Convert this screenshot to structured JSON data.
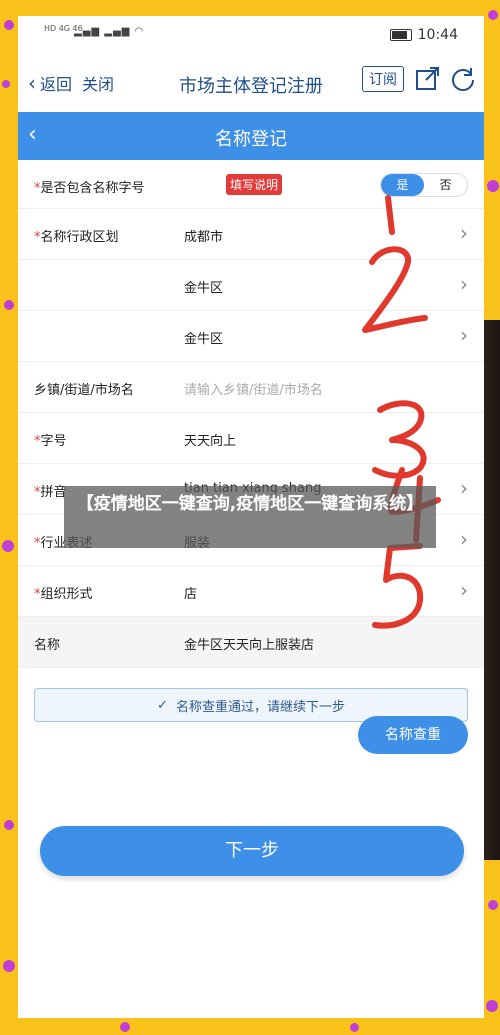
{
  "status_bar": {
    "network_badges": "HD 4G 46",
    "time": "10:44"
  },
  "navbar": {
    "back_label": "返回",
    "close_label": "关闭",
    "title": "市场主体登记注册",
    "subscribe_label": "订阅"
  },
  "header": {
    "title": "名称登记"
  },
  "form": {
    "contains_name_char": {
      "label": "是否包含名称字号",
      "help": "填写说明",
      "yes": "是",
      "no": "否"
    },
    "admin_region": {
      "label": "名称行政区划",
      "value1": "成都市",
      "value2": "金牛区",
      "value3": "金牛区"
    },
    "town": {
      "label": "乡镇/街道/市场名",
      "placeholder": "请输入乡镇/街道/市场名"
    },
    "trade_name": {
      "label": "字号",
      "value": "天天向上"
    },
    "pinyin": {
      "label": "拼音",
      "value": "tian tian xiang shang"
    },
    "industry": {
      "label": "行业表述",
      "value": "服装"
    },
    "org_form": {
      "label": "组织形式",
      "value": "店"
    },
    "name": {
      "label": "名称",
      "value": "金牛区天天向上服装店"
    }
  },
  "notice": "名称查重通过，请继续下一步",
  "buttons": {
    "check": "名称查重",
    "next": "下一步"
  },
  "overlay_title": "【疫情地区一键查询,疫情地区一键查询系统】",
  "handwriting": [
    "1",
    "2",
    "3",
    "4",
    "5"
  ],
  "colors": {
    "accent": "#3d8fe8",
    "nav_text": "#1e4e8c",
    "required": "#e53a3a",
    "frame": "#f8c21a",
    "handwriting": "#e0382c"
  }
}
